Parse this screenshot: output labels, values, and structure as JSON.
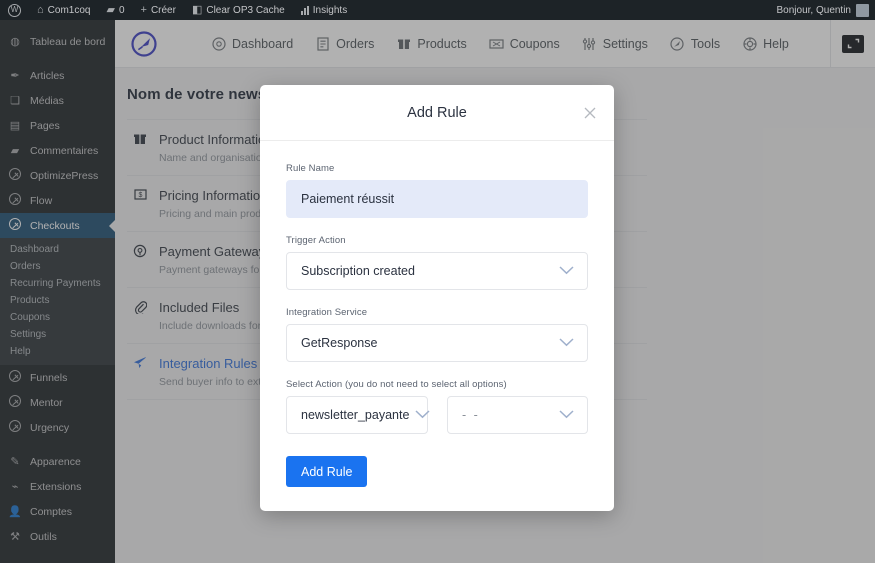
{
  "adminbar": {
    "wp_logo": "wordpress-logo-icon",
    "site_name": "Com1coq",
    "comments_count": "0",
    "create_label": "Créer",
    "clear_cache_label": "Clear OP3 Cache",
    "insights_label": "Insights",
    "greeting": "Bonjour, Quentin"
  },
  "sidebar": {
    "items": [
      {
        "label": "Tableau de bord",
        "icon": "dashboard-icon",
        "glyph": "◉"
      },
      {
        "label": "Articles",
        "icon": "pin-icon",
        "glyph": "📌"
      },
      {
        "label": "Médias",
        "icon": "media-icon",
        "glyph": "♫"
      },
      {
        "label": "Pages",
        "icon": "page-icon",
        "glyph": "▯"
      },
      {
        "label": "Commentaires",
        "icon": "comment-icon",
        "glyph": "💬"
      },
      {
        "label": "OptimizePress",
        "icon": "rocket-icon",
        "glyph": ""
      },
      {
        "label": "Flow",
        "icon": "rocket-icon",
        "glyph": ""
      },
      {
        "label": "Checkouts",
        "icon": "rocket-icon",
        "glyph": "",
        "active": true
      }
    ],
    "submenu": [
      {
        "label": "Dashboard"
      },
      {
        "label": "Orders"
      },
      {
        "label": "Recurring Payments"
      },
      {
        "label": "Products"
      },
      {
        "label": "Coupons"
      },
      {
        "label": "Settings"
      },
      {
        "label": "Help"
      }
    ],
    "items_after": [
      {
        "label": "Funnels",
        "icon": "rocket-icon"
      },
      {
        "label": "Mentor",
        "icon": "rocket-icon"
      },
      {
        "label": "Urgency",
        "icon": "rocket-icon"
      }
    ],
    "items_tail": [
      {
        "label": "Apparence",
        "icon": "brush-icon",
        "glyph": "🖌"
      },
      {
        "label": "Extensions",
        "icon": "plug-icon",
        "glyph": "🔌"
      },
      {
        "label": "Comptes",
        "icon": "user-icon",
        "glyph": "👤"
      },
      {
        "label": "Outils",
        "icon": "tools-icon",
        "glyph": "🔧"
      }
    ]
  },
  "appnav": {
    "logo": "optimizepress-rocket-logo",
    "links": [
      {
        "label": "Dashboard",
        "icon": "gauge-icon"
      },
      {
        "label": "Orders",
        "icon": "receipt-icon"
      },
      {
        "label": "Products",
        "icon": "box-icon"
      },
      {
        "label": "Coupons",
        "icon": "ticket-icon"
      },
      {
        "label": "Settings",
        "icon": "sliders-icon"
      },
      {
        "label": "Tools",
        "icon": "rocket-icon"
      },
      {
        "label": "Help",
        "icon": "lifebuoy-icon"
      }
    ],
    "expand": "expand-fullscreen-icon"
  },
  "page": {
    "title": "Nom de votre newsl",
    "sections": [
      {
        "title": "Product Information",
        "sub": "Name and organisation of p",
        "icon": "box-icon"
      },
      {
        "title": "Pricing Information",
        "sub": "Pricing and main product in",
        "icon": "price-tag-icon"
      },
      {
        "title": "Payment Gateways",
        "sub": "Payment gateways for this",
        "icon": "gateway-icon"
      },
      {
        "title": "Included Files",
        "sub": "Include downloads for your",
        "icon": "paperclip-icon"
      },
      {
        "title": "Integration Rules",
        "sub": "Send buyer info to external",
        "icon": "send-icon",
        "current": true
      }
    ]
  },
  "modal": {
    "title": "Add Rule",
    "close_icon": "close-icon",
    "fields": {
      "rule_name": {
        "label": "Rule Name",
        "value": "Paiement réussit",
        "placeholder": "Rule Name"
      },
      "trigger_action": {
        "label": "Trigger Action",
        "value": "Subscription created"
      },
      "integration_service": {
        "label": "Integration Service",
        "value": "GetResponse"
      },
      "select_action": {
        "label": "Select Action (you do not need to select all options)",
        "value_left": "newsletter_payante",
        "value_right": "- -"
      }
    },
    "submit_label": "Add Rule"
  },
  "colors": {
    "accent_blue": "#1a73f0",
    "wp_dark": "#1d2327",
    "wp_active": "#1d4e73",
    "link_blue": "#2f6fdd",
    "input_focus_bg": "#e4eaf9"
  }
}
